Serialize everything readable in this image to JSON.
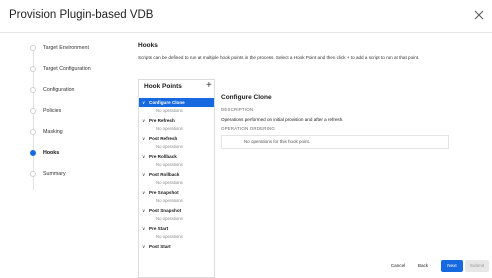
{
  "modal": {
    "title": "Provision Plugin-based VDB"
  },
  "steps": [
    {
      "label": "Target Environment",
      "active": false
    },
    {
      "label": "Target Configuration",
      "active": false
    },
    {
      "label": "Configuration",
      "active": false
    },
    {
      "label": "Policies",
      "active": false
    },
    {
      "label": "Masking",
      "active": false
    },
    {
      "label": "Hooks",
      "active": true
    },
    {
      "label": "Summary",
      "active": false
    }
  ],
  "hooks": {
    "heading": "Hooks",
    "description": "Scripts can be defined to run at multiple hook points in the process. Select a Hook Point and then click + to add a script to run at that point.",
    "panel_title": "Hook Points",
    "add_symbol": "+",
    "points": [
      {
        "name": "Configure Clone",
        "ops": "No operations",
        "selected": true
      },
      {
        "name": "Pre Refresh",
        "ops": "No operations",
        "selected": false
      },
      {
        "name": "Post Refresh",
        "ops": "No operations",
        "selected": false
      },
      {
        "name": "Pre Rollback",
        "ops": "No operations",
        "selected": false
      },
      {
        "name": "Post Rollback",
        "ops": "No operations",
        "selected": false
      },
      {
        "name": "Pre Snapshot",
        "ops": "No operations",
        "selected": false
      },
      {
        "name": "Post Snapshot",
        "ops": "No operations",
        "selected": false
      },
      {
        "name": "Pre Start",
        "ops": "No operations",
        "selected": false
      },
      {
        "name": "Post Start",
        "ops": "",
        "selected": false
      }
    ]
  },
  "detail": {
    "title": "Configure Clone",
    "description_label": "DESCRIPTION",
    "description_text": "Operations performed on initial provision and after a refresh.",
    "ordering_label": "OPERATION ORDERING",
    "empty_text": "No operations for this hook point."
  },
  "footer": {
    "cancel": "Cancel",
    "back": "Back",
    "next": "Next",
    "submit": "Submit"
  },
  "colors": {
    "accent": "#1769e0",
    "disabled": "#e7e7e7"
  },
  "icons": {
    "close": "close-icon",
    "add": "plus-icon",
    "expand": "chevron-down-icon"
  }
}
